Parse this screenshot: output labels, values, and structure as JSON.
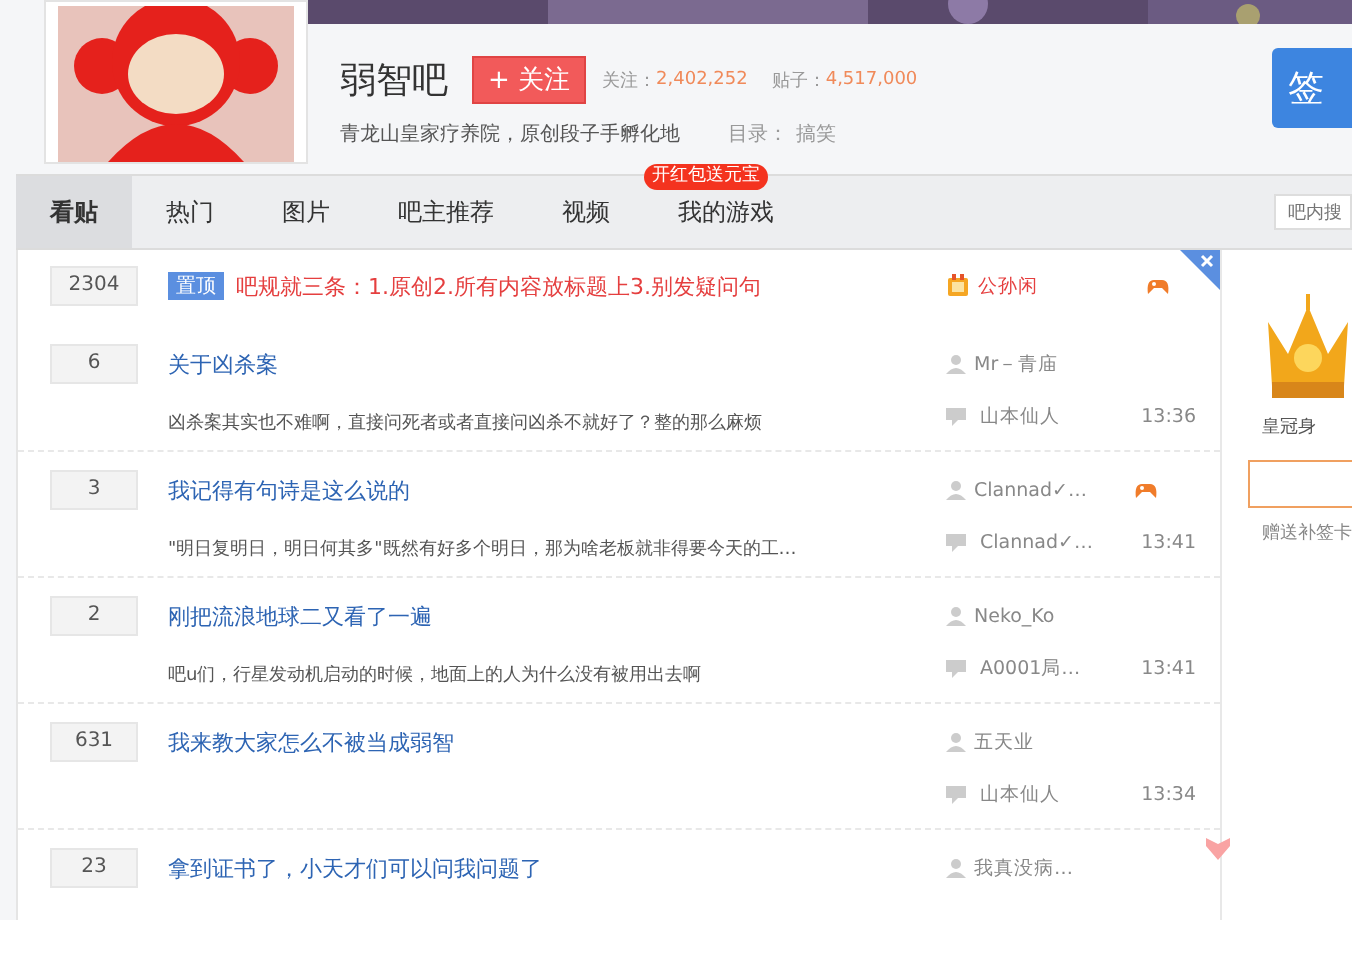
{
  "forum": {
    "name": "弱智吧",
    "follow_button": "+ 关注",
    "stats": [
      {
        "label": "关注：",
        "value": "2,402,252"
      },
      {
        "label": "贴子：",
        "value": "4,517,000"
      }
    ],
    "description": "青龙山皇家疗养院，原创段子手孵化地",
    "category_label": "目录：",
    "category_value": "搞笑",
    "sign_button": "签"
  },
  "nav": {
    "tabs": [
      {
        "label": "看贴",
        "selected": true
      },
      {
        "label": "热门",
        "selected": false
      },
      {
        "label": "图片",
        "selected": false
      },
      {
        "label": "吧主推荐",
        "selected": false
      },
      {
        "label": "视频",
        "selected": false
      },
      {
        "label": "我的游戏",
        "selected": false,
        "badge": "开红包送元宝"
      }
    ],
    "search": {
      "placeholder": "吧内搜"
    }
  },
  "threads": [
    {
      "kind": "pinned",
      "replies": "2304",
      "tag": "置顶",
      "title": "吧规就三条：1.原创2.所有内容放标题上3.别发疑问句",
      "author": "公孙闲",
      "game_badge": true
    },
    {
      "kind": "normal",
      "replies": "6",
      "title": "关于凶杀案",
      "excerpt": "凶杀案其实也不难啊，直接问死者或者直接问凶杀不就好了？整的那么麻烦",
      "author": "Mr－青庙",
      "last_reply": "山本仙人",
      "time": "13:36",
      "game_badge": false
    },
    {
      "kind": "normal",
      "replies": "3",
      "title": "我记得有句诗是这么说的",
      "excerpt": "\"明日复明日，明日何其多\"既然有好多个明日，那为啥老板就非得要今天的工…",
      "author": "Clannad✓…",
      "last_reply": "Clannad✓…",
      "time": "13:41",
      "game_badge": true
    },
    {
      "kind": "normal",
      "replies": "2",
      "title": "刚把流浪地球二又看了一遍",
      "excerpt": "吧u们，行星发动机启动的时候，地面上的人为什么没有被用出去啊",
      "author": "Neko_Ko",
      "last_reply": "A0001局…",
      "time": "13:41",
      "game_badge": false
    },
    {
      "kind": "normal",
      "replies": "631",
      "title": "我来教大家怎么不被当成弱智",
      "author": "五天业",
      "last_reply": "山本仙人",
      "time": "13:34",
      "game_badge": false
    },
    {
      "kind": "normal",
      "replies": "23",
      "title": "拿到证书了，小天才们可以问我问题了",
      "author": "我真没病…",
      "game_badge": false
    }
  ],
  "sidebar": {
    "crown_label": "皇冠身",
    "gift_text": "赠送补签卡"
  }
}
